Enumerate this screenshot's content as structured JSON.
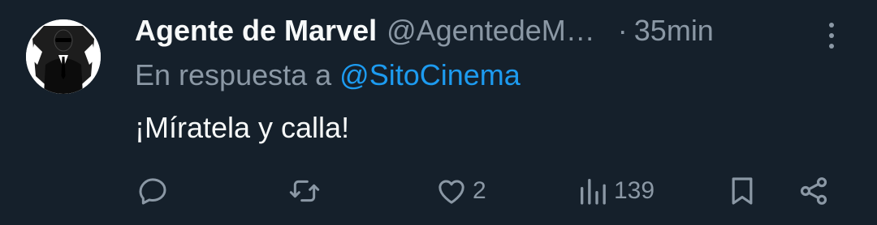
{
  "tweet": {
    "display_name": "Agente de Marvel",
    "handle": "@AgentedeM…",
    "separator": "·",
    "time": "35min",
    "reply_prefix": "En respuesta a ",
    "reply_to": "@SitoCinema",
    "text": "¡Míratela y calla!",
    "avatar_icon": "agent-silhouette-icon"
  },
  "actions": {
    "reply": {
      "icon": "reply-icon",
      "count": ""
    },
    "retweet": {
      "icon": "retweet-icon",
      "count": ""
    },
    "like": {
      "icon": "heart-icon",
      "count": "2"
    },
    "views": {
      "icon": "views-icon",
      "count": "139"
    },
    "bookmark": {
      "icon": "bookmark-icon"
    },
    "share": {
      "icon": "share-icon"
    }
  },
  "colors": {
    "background": "#15202b",
    "primary_text": "#f7f9f9",
    "secondary_text": "#8b98a5",
    "link": "#1d9bf0"
  }
}
